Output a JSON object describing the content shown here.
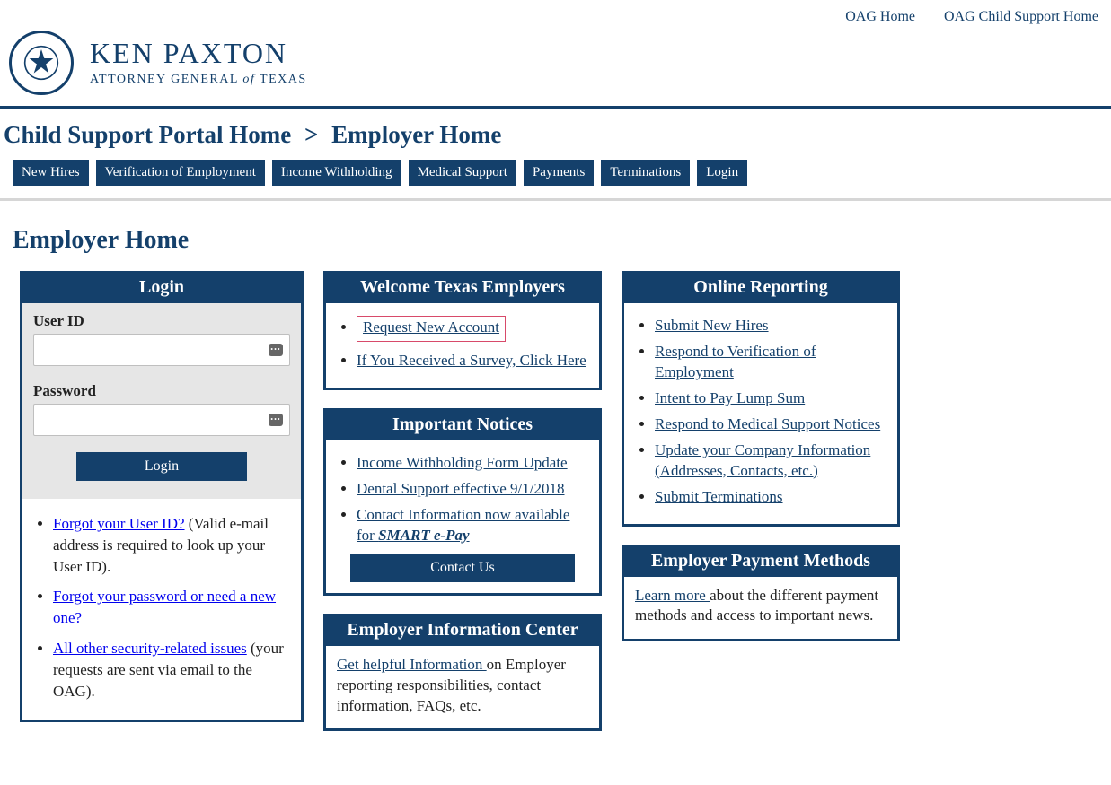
{
  "topLinks": {
    "oagHome": "OAG Home",
    "csHome": "OAG Child Support Home"
  },
  "logo": {
    "name": "KEN PAXTON",
    "subtitlePrefix": "ATTORNEY GENERAL ",
    "subtitleOf": "of",
    "subtitleSuffix": " TEXAS"
  },
  "breadcrumb": {
    "portal": "Child Support Portal Home",
    "sep": ">",
    "current": "Employer Home"
  },
  "tabs": {
    "t0": "New Hires",
    "t1": "Verification of Employment",
    "t2": "Income Withholding",
    "t3": "Medical Support",
    "t4": "Payments",
    "t5": "Terminations",
    "t6": "Login"
  },
  "pageTitle": "Employer Home",
  "login": {
    "header": "Login",
    "userIdLabel": "User ID",
    "passwordLabel": "Password",
    "button": "Login",
    "forgotUserLink": "Forgot your User ID?",
    "forgotUserTail": " (Valid e-mail address is required to look up your User ID).",
    "forgotPassword": "Forgot your password or need a new one?",
    "securityLink": "All other security-related issues",
    "securityTail": " (your requests are sent via email to the OAG)."
  },
  "welcome": {
    "header": "Welcome Texas Employers",
    "requestNew": "Request New Account",
    "survey": "If You Received a Survey, Click Here"
  },
  "notices": {
    "header": "Important Notices",
    "n0": "Income Withholding Form Update",
    "n1": "Dental Support effective 9/1/2018",
    "n2a": "Contact Information now available for ",
    "n2b": "SMART e-Pay",
    "contactBtn": "Contact Us"
  },
  "infoCenter": {
    "header": "Employer Information Center",
    "link": "Get helpful Information ",
    "tail": "on Employer reporting responsibilities, contact information, FAQs, etc."
  },
  "reporting": {
    "header": "Online Reporting",
    "r0": "Submit New Hires",
    "r1": "Respond to Verification of Employment",
    "r2": "Intent to Pay Lump Sum",
    "r3": "Respond to Medical Support Notices",
    "r4": "Update your Company Information (Addresses, Contacts, etc.)",
    "r5": "Submit Terminations"
  },
  "paymentMethods": {
    "header": "Employer Payment Methods",
    "link": "Learn more ",
    "tail": "about the different payment methods and access to important news."
  }
}
